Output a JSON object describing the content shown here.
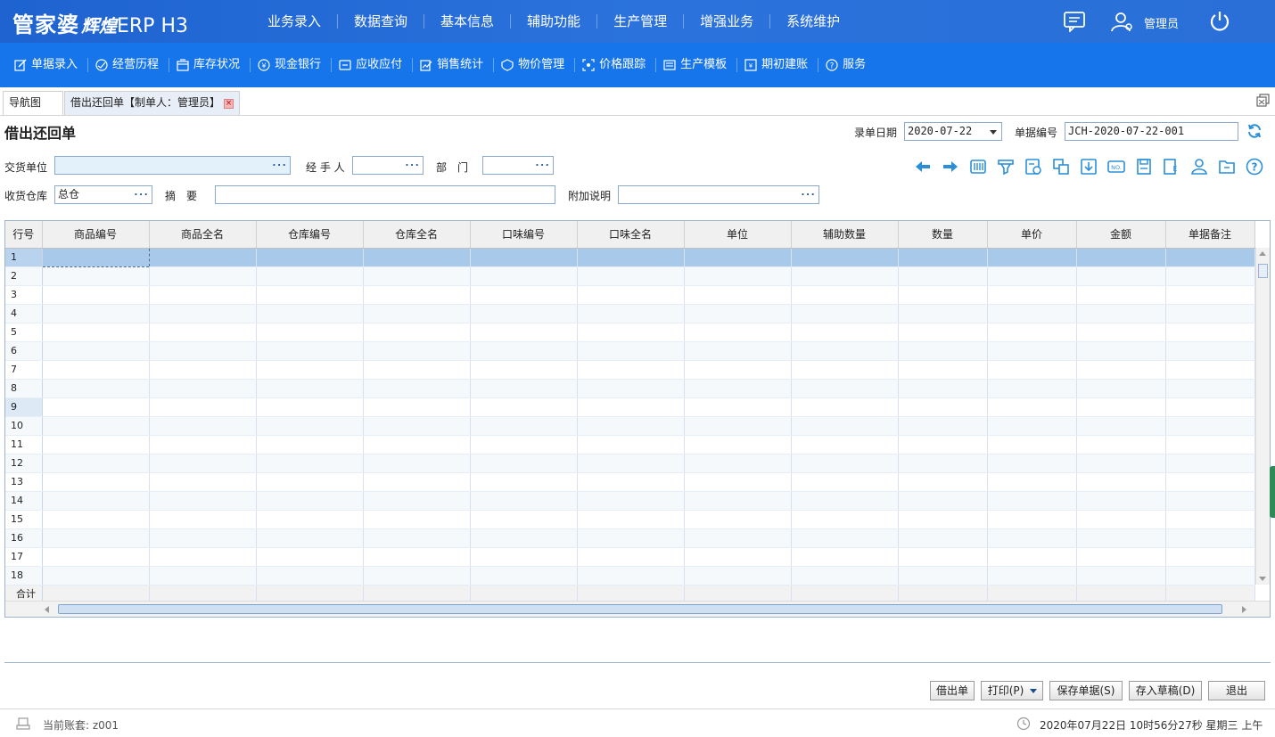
{
  "header": {
    "brand_main": "管家婆",
    "brand_sub": "辉煌",
    "brand_product": "ERP H3",
    "nav": [
      "业务录入",
      "数据查询",
      "基本信息",
      "辅助功能",
      "生产管理",
      "增强业务",
      "系统维护"
    ],
    "user": "管理员"
  },
  "toolbar": {
    "items": [
      {
        "label": "单据录入",
        "icon": "edit-icon"
      },
      {
        "label": "经营历程",
        "icon": "history-icon"
      },
      {
        "label": "库存状况",
        "icon": "inventory-icon"
      },
      {
        "label": "现金银行",
        "icon": "cash-icon"
      },
      {
        "label": "应收应付",
        "icon": "receivable-icon"
      },
      {
        "label": "销售统计",
        "icon": "sales-icon"
      },
      {
        "label": "物价管理",
        "icon": "price-icon"
      },
      {
        "label": "价格跟踪",
        "icon": "tracking-icon"
      },
      {
        "label": "生产模板",
        "icon": "template-icon"
      },
      {
        "label": "期初建账",
        "icon": "opening-icon"
      },
      {
        "label": "服务",
        "icon": "help-icon"
      }
    ]
  },
  "tabs": {
    "nav_label": "导航图",
    "active_label": "借出还回单【制单人：管理员】",
    "close_glyph": "×"
  },
  "form": {
    "title": "借出还回单",
    "date_label": "录单日期",
    "date_value": "2020-07-22",
    "number_label": "单据编号",
    "number_value": "JCH-2020-07-22-001",
    "supplier_label": "交货单位",
    "supplier_value": "",
    "handler_label": "经 手 人",
    "handler_value": "",
    "dept_label": "部　门",
    "dept_value": "",
    "warehouse_label": "收货仓库",
    "warehouse_value": "总仓",
    "summary_label": "摘　要",
    "summary_value": "",
    "note_label": "附加说明",
    "note_value": "",
    "more_glyph": "···"
  },
  "grid": {
    "columns": [
      "行号",
      "商品编号",
      "商品全名",
      "仓库编号",
      "仓库全名",
      "口味编号",
      "口味全名",
      "单位",
      "辅助数量",
      "数量",
      "单价",
      "金额",
      "单据备注"
    ],
    "rows": [
      "1",
      "2",
      "3",
      "4",
      "5",
      "6",
      "7",
      "8",
      "9",
      "10",
      "11",
      "12",
      "13",
      "14",
      "15",
      "16",
      "17",
      "18"
    ],
    "sum_label": "合计"
  },
  "buttons": {
    "lend": "借出单",
    "print": "打印(P)",
    "save": "保存单据(S)",
    "draft": "存入草稿(D)",
    "exit": "退出"
  },
  "status": {
    "account": "当前账套:   z001",
    "datetime": "2020年07月22日 10时56分27秒 星期三 上午"
  }
}
